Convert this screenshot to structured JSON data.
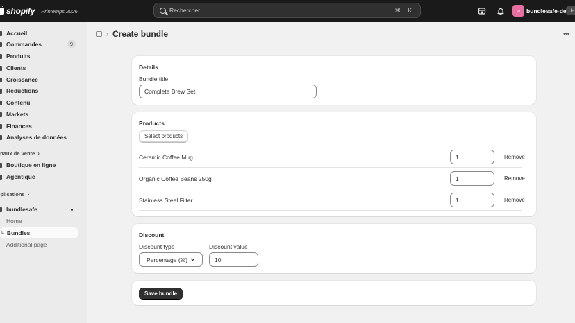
{
  "topbar": {
    "logo_text": "shopify",
    "season": "Printemps 2026",
    "search_placeholder": "Rechercher",
    "search_shortcut": "⌘ K",
    "avatar_initials": "bs",
    "store_name": "bundlesafe-dev",
    "env_badge": "dev"
  },
  "sidebar": {
    "items": [
      {
        "label": "Accueil"
      },
      {
        "label": "Commandes",
        "count": "9"
      },
      {
        "label": "Produits"
      },
      {
        "label": "Clients"
      },
      {
        "label": "Croissance"
      },
      {
        "label": "Réductions"
      },
      {
        "label": "Contenu"
      },
      {
        "label": "Markets"
      },
      {
        "label": "Finances"
      },
      {
        "label": "Analyses de données"
      }
    ],
    "sales_channels_heading": "anaux de vente",
    "sales_channels": [
      {
        "label": "Boutique en ligne"
      },
      {
        "label": "Agentique"
      }
    ],
    "apps_heading": "pplications",
    "app_name": "bundlesafe",
    "app_subitems": [
      {
        "label": "Home"
      },
      {
        "label": "Bundles"
      },
      {
        "label": "Additional page"
      }
    ]
  },
  "page": {
    "title": "Create bundle"
  },
  "details": {
    "heading": "Details",
    "bundle_title_label": "Bundle title",
    "bundle_title_value": "Complete Brew Set"
  },
  "products": {
    "heading": "Products",
    "select_button": "Select products",
    "remove_label": "Remove",
    "rows": [
      {
        "name": "Ceramic Coffee Mug",
        "qty": "1"
      },
      {
        "name": "Organic Coffee Beans 250g",
        "qty": "1"
      },
      {
        "name": "Stainless Steel Filter",
        "qty": "1"
      }
    ]
  },
  "discount": {
    "heading": "Discount",
    "type_label": "Discount type",
    "type_value": "Percentage (%)",
    "value_label": "Discount value",
    "value": "10"
  },
  "actions": {
    "save_label": "Save bundle"
  }
}
